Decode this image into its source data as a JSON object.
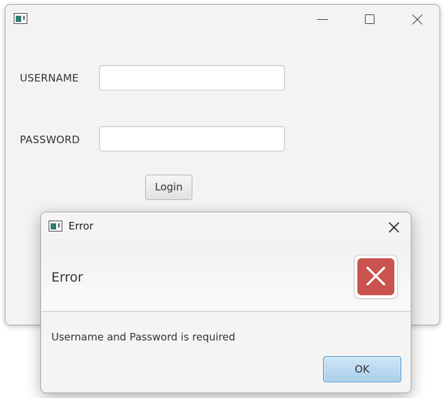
{
  "main_window": {
    "title": "",
    "icon": "app-window-icon",
    "controls": [
      "minimize-icon",
      "maximize-icon",
      "close-icon"
    ],
    "form": {
      "username_label": "USERNAME",
      "username_value": "",
      "password_label": "PASSWORD",
      "password_value": "",
      "login_label": "Login"
    }
  },
  "dialog": {
    "title": "Error",
    "icon": "app-window-icon",
    "heading": "Error",
    "status_icon": "error-x-icon",
    "message": "Username and Password is required",
    "ok_label": "OK"
  },
  "colors": {
    "window_bg": "#f3f3f3",
    "error_red": "#c9534f",
    "default_button_blue": "#a9cfe9",
    "default_button_border": "#3d8ec7"
  }
}
